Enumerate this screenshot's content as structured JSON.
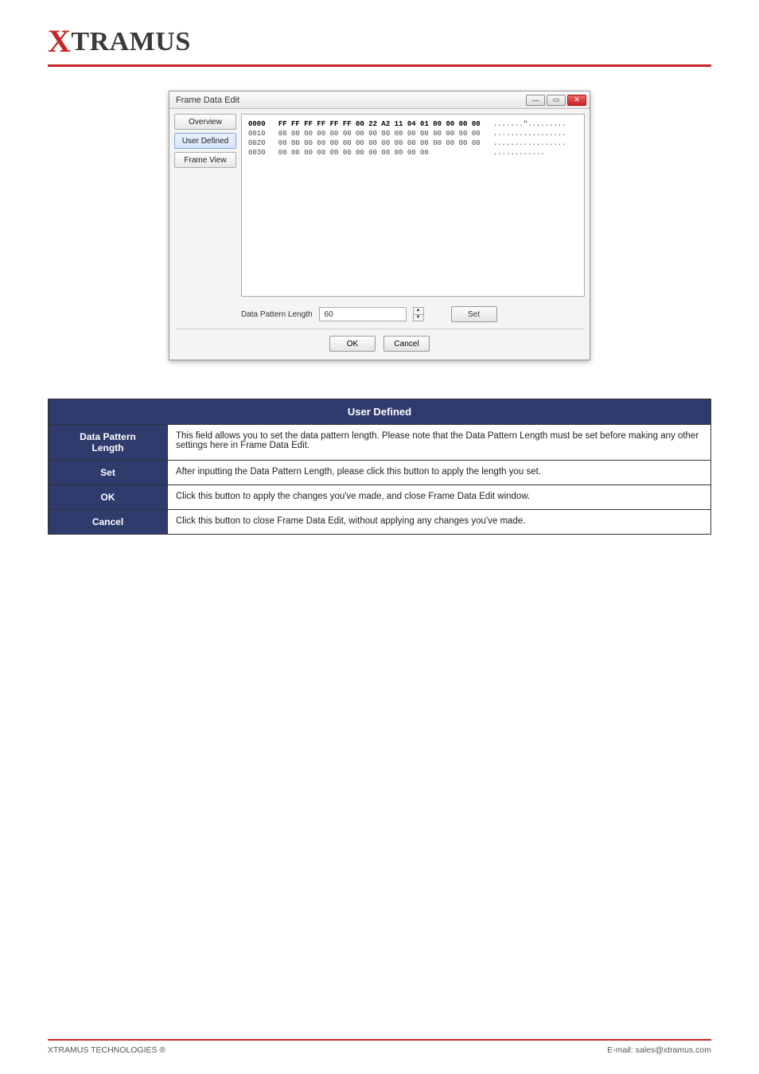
{
  "logo_text": "XTRAMUS",
  "dialog": {
    "title": "Frame Data Edit",
    "tabs": {
      "overview": "Overview",
      "user_defined": "User Defined",
      "frame_view": "Frame View"
    },
    "hex": {
      "l0_offset": "0000",
      "l0_hex": "FF FF FF FF FF FF 00 22 A2 11 04 01 00 00 00 00",
      "l0_ascii": ".......\".........",
      "l1": "0010   00 00 00 00 00 00 00 00 00 00 00 00 00 00 00 00   .................",
      "l2": "0020   00 00 00 00 00 00 00 00 00 00 00 00 00 00 00 00   .................",
      "l3": "0030   00 00 00 00 00 00 00 00 00 00 00 00               ............"
    },
    "dpl_label": "Data Pattern Length",
    "dpl_value": "60",
    "set_label": "Set",
    "ok_label": "OK",
    "cancel_label": "Cancel"
  },
  "table": {
    "header": "User Defined",
    "rows": [
      {
        "label": "Data Pattern\nLength",
        "desc": "This field allows you to set the data pattern length. Please note that the Data Pattern Length must be set before making any other settings here in Frame Data Edit."
      },
      {
        "label": "Set",
        "desc": "After inputting the Data Pattern Length, please click this button to apply the length you set."
      },
      {
        "label": "OK",
        "desc": "Click this button to apply the changes you've made, and close Frame Data Edit window."
      },
      {
        "label": "Cancel",
        "desc": "Click this button to close Frame Data Edit, without applying any changes you've made."
      }
    ]
  },
  "footer": {
    "left": "XTRAMUS TECHNOLOGIES ®",
    "right": "E-mail: sales@xtramus.com"
  }
}
